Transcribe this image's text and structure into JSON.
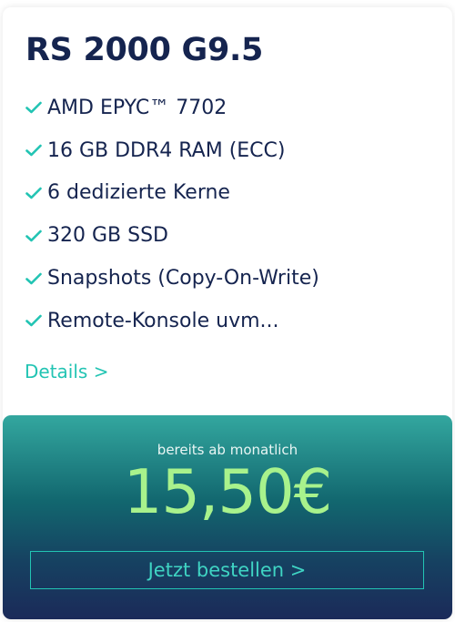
{
  "product": {
    "title": "RS 2000 G9.5",
    "features": [
      {
        "label": "AMD EPYC™ 7702",
        "icon": "check-icon"
      },
      {
        "label": "16 GB DDR4 RAM (ECC)",
        "icon": "check-icon"
      },
      {
        "label": "6 dedizierte Kerne",
        "icon": "check-icon"
      },
      {
        "label": "320 GB SSD",
        "icon": "check-icon"
      },
      {
        "label": "Snapshots (Copy-On-Write)",
        "icon": "check-icon"
      },
      {
        "label": "Remote-Konsole uvm..."
      }
    ],
    "details_link": "Details >"
  },
  "pricing": {
    "from_label": "bereits ab monatlich",
    "price": "15,50€",
    "order_button": "Jetzt bestellen >"
  },
  "colors": {
    "title": "#15244f",
    "accent": "#22c4b3",
    "price": "#a8f28c",
    "panel_top": "#33a79f",
    "panel_bottom": "#1b2a59"
  }
}
